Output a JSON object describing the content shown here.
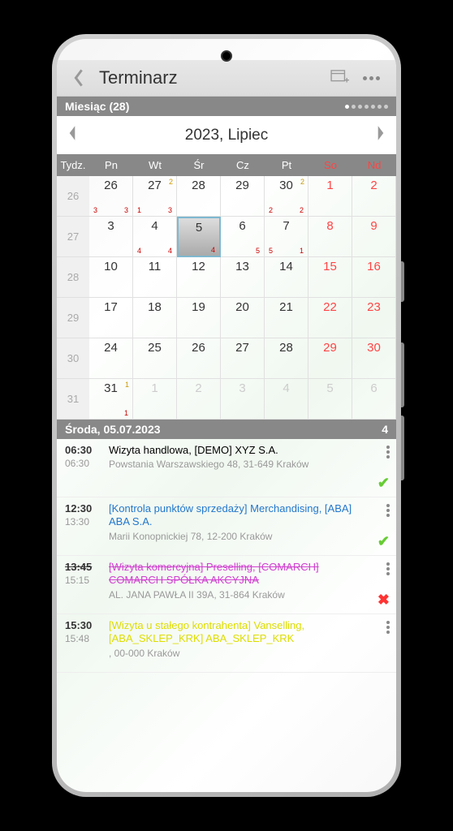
{
  "header": {
    "title": "Terminarz"
  },
  "monthBar": {
    "label": "Miesiąc (28)"
  },
  "monthNav": {
    "label": "2023, Lipiec"
  },
  "weekdays": [
    "Tydz.",
    "Pn",
    "Wt",
    "Śr",
    "Cz",
    "Pt",
    "So",
    "Nd"
  ],
  "weeks": [
    {
      "num": "26",
      "days": [
        {
          "d": "26",
          "sub": "3",
          "sub2": "3"
        },
        {
          "d": "27",
          "sup": "2",
          "sub": "1",
          "sub2": "3"
        },
        {
          "d": "28"
        },
        {
          "d": "29"
        },
        {
          "d": "30",
          "sup": "2",
          "sub": "2",
          "sub2": "2"
        },
        {
          "d": "1",
          "weekend": true
        },
        {
          "d": "2",
          "weekend": true
        }
      ]
    },
    {
      "num": "27",
      "days": [
        {
          "d": "3"
        },
        {
          "d": "4",
          "sub": "4",
          "sub2": "4"
        },
        {
          "d": "5",
          "selected": true,
          "sub2": "4"
        },
        {
          "d": "6",
          "sub2": "5"
        },
        {
          "d": "7",
          "sub": "5",
          "sub2": "1"
        },
        {
          "d": "8",
          "weekend": true
        },
        {
          "d": "9",
          "weekend": true
        }
      ]
    },
    {
      "num": "28",
      "days": [
        {
          "d": "10"
        },
        {
          "d": "11"
        },
        {
          "d": "12"
        },
        {
          "d": "13"
        },
        {
          "d": "14"
        },
        {
          "d": "15",
          "weekend": true
        },
        {
          "d": "16",
          "weekend": true
        }
      ]
    },
    {
      "num": "29",
      "days": [
        {
          "d": "17"
        },
        {
          "d": "18"
        },
        {
          "d": "19"
        },
        {
          "d": "20"
        },
        {
          "d": "21"
        },
        {
          "d": "22",
          "weekend": true
        },
        {
          "d": "23",
          "weekend": true
        }
      ]
    },
    {
      "num": "30",
      "days": [
        {
          "d": "24"
        },
        {
          "d": "25"
        },
        {
          "d": "26"
        },
        {
          "d": "27"
        },
        {
          "d": "28"
        },
        {
          "d": "29",
          "weekend": true
        },
        {
          "d": "30",
          "weekend": true
        }
      ]
    },
    {
      "num": "31",
      "days": [
        {
          "d": "31",
          "sup": "1",
          "sub2": "1"
        },
        {
          "d": "1",
          "other": true
        },
        {
          "d": "2",
          "other": true
        },
        {
          "d": "3",
          "other": true
        },
        {
          "d": "4",
          "other": true
        },
        {
          "d": "5",
          "other": true
        },
        {
          "d": "6",
          "other": true
        }
      ]
    }
  ],
  "dayBar": {
    "date": "Środa, 05.07.2023",
    "count": "4"
  },
  "events": [
    {
      "t1": "06:30",
      "t2": "06:30",
      "title": "Wizyta handlowa, [DEMO] XYZ S.A.",
      "addr": "Powstania Warszawskiego 48, 31-649 Kraków",
      "color": "black",
      "status": "done"
    },
    {
      "t1": "12:30",
      "t2": "13:30",
      "title": "[Kontrola punktów sprzedaży] Merchandising, [ABA] ABA S.A.",
      "addr": "Marii Konopnickiej 78, 12-200 Kraków",
      "color": "blue",
      "status": "done"
    },
    {
      "t1": "13:45",
      "t2": "15:15",
      "t1strike": true,
      "title": "[Wizyta komercyjna] Preselling, [COMARCH] COMARCH SPÓŁKA AKCYJNA",
      "addr": "AL. JANA PAWŁA II 39A, 31-864 Kraków",
      "color": "magenta",
      "status": "cancel"
    },
    {
      "t1": "15:30",
      "t2": "15:48",
      "title": "[Wizyta u stałego kontrahenta] Vanselling, [ABA_SKLEP_KRK] ABA_SKLEP_KRK",
      "addr": ", 00-000 Kraków",
      "color": "yellow",
      "status": ""
    }
  ]
}
